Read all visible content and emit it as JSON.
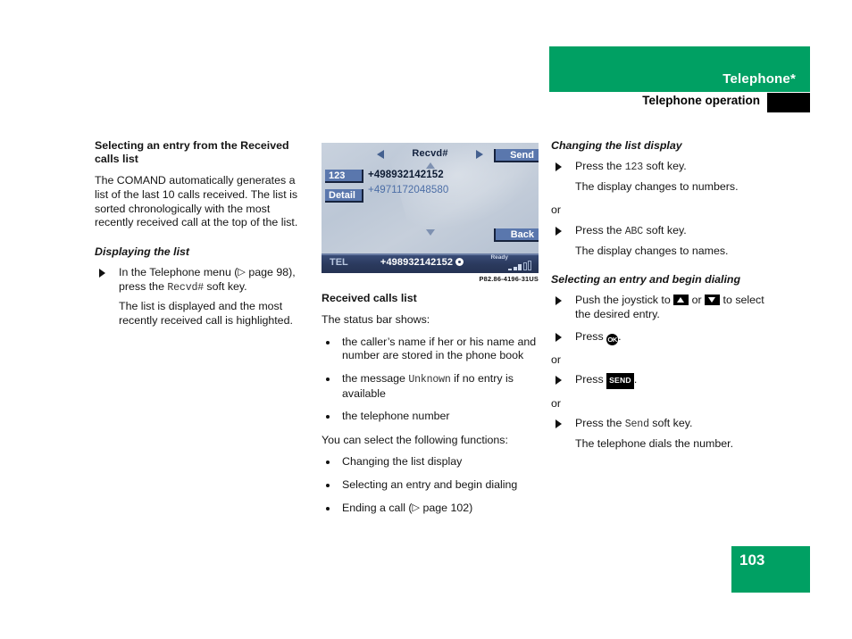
{
  "header": {
    "title": "Telephone*",
    "subtitle": "Telephone operation",
    "green": "#00a063"
  },
  "page_number": "103",
  "figure": {
    "caption": "P82.86-4196-31US",
    "screen": {
      "title": "Recvd#",
      "softkey_123": "123",
      "softkey_detail": "Detail",
      "softkey_send": "Send",
      "softkey_back": "Back",
      "entry_selected": "+498932142152",
      "entry_second": "+4971172048580",
      "status_mode": "TEL",
      "status_number": "+498932142152",
      "status_ready": "Ready"
    }
  },
  "col1": {
    "heading": "Selecting an entry from the Received calls list",
    "intro": "The COMAND automatically generates a list of the last 10 calls received. The list is sorted chronologically with the most recently received call at the top of the list.",
    "sub_heading": "Displaying the list",
    "step1_a": "In the Telephone menu (",
    "step1_page": "page 98),",
    "step1_b": "press the ",
    "step1_key": "Recvd#",
    "step1_c": " soft key.",
    "result1": "The list is displayed and the most recently received call is highlighted."
  },
  "col2": {
    "heading": "Received calls list",
    "lead": "The status bar shows:",
    "bullets": [
      "the caller’s name if her or his name and number are stored in the phone book",
      "the telephone number"
    ],
    "bullet_unknown_a": "the message ",
    "bullet_unknown_key": "Unknown",
    "bullet_unknown_b": " if no entry is available",
    "lead2": "You can select the following functions:",
    "bullets2": [
      "Changing the list display",
      "Selecting an entry and begin dialing"
    ],
    "bullet_end_a": "Ending a call (",
    "bullet_end_page": "page 102)"
  },
  "col3": {
    "heading1": "Changing the list display",
    "s1_a": "Press the ",
    "s1_key": "123",
    "s1_b": " soft key.",
    "r1": "The display changes to numbers.",
    "or1": "or",
    "s2_a": "Press the ",
    "s2_key": "ABC",
    "s2_b": " soft key.",
    "r2": "The display changes to names.",
    "heading2": "Selecting an entry and begin dialing",
    "s3_a": "Push the joystick to ",
    "s3_or": " or ",
    "s3_b": " to select the desired entry.",
    "s4_a": "Press ",
    "s4_key": "OK",
    "s4_b": ".",
    "or2": "or",
    "s5_a": "Press ",
    "s5_key": "SEND",
    "s5_b": ".",
    "or3": "or",
    "s6_a": "Press the ",
    "s6_key": "Send",
    "s6_b": " soft key.",
    "r3": "The telephone dials the number."
  }
}
